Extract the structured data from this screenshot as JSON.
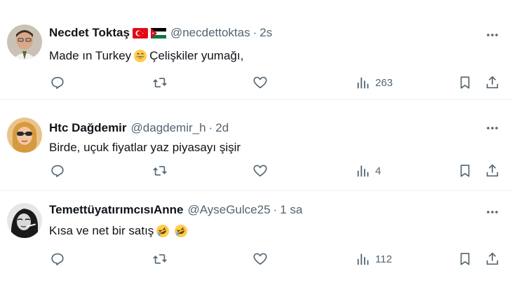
{
  "tweets": [
    {
      "name": "Necdet Toktaş",
      "handle": "@necdettoktas",
      "separator": "·",
      "time": "2s",
      "text_before": "Made ın Turkey",
      "text_after": "Çelişkiler yumağı,",
      "views": "263",
      "flags": [
        "turkey-flag",
        "jordan-flag"
      ],
      "emojis": [
        "grinning-face-emoji"
      ]
    },
    {
      "name": "Htc Dağdemir",
      "handle": "@dagdemir_h",
      "separator": "·",
      "time": "2d",
      "text_before": "Birde, uçuk fiyatlar yaz piyasayı şişir",
      "views": "4"
    },
    {
      "name": "TemettüyatırımcısıAnne",
      "handle": "@AyseGulce25",
      "separator": "·",
      "time": "1 sa",
      "text_before": "Kısa ve net bir satış",
      "views": "112",
      "emojis": [
        "rolling-laughing-emoji",
        "rolling-laughing-emoji"
      ]
    }
  ],
  "colors": {
    "text": "#0f1419",
    "secondary": "#536471",
    "divider": "#eff3f4"
  }
}
